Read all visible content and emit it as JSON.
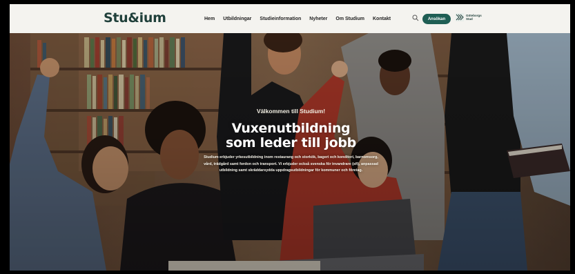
{
  "header": {
    "logo": "Stu&ium",
    "nav": [
      "Hem",
      "Utbildningar",
      "Studieinformation",
      "Nyheter",
      "Om Studium",
      "Kontakt"
    ],
    "apply_label": "Ansökan",
    "city_logo_text": "Göteborgs Stad"
  },
  "hero": {
    "welcome": "Välkommen till Studium!",
    "headline_line1": "Vuxenutbildning",
    "headline_line2": "som leder till jobb",
    "intro": "Studium erbjuder yrkesutbildning inom restaurang och storkök, bageri och konditori, barnomsorg, vård, trädgård samt fordon och transport. Vi erbjuder också svenska för invandrare (sfi), anpassad utbildning samt skräddarsydda uppdragsutbildningar för kommuner och företag."
  },
  "colors": {
    "brand": "#1f5e54",
    "logo": "#1f3f3a",
    "header_bg": "#f4f3ef"
  },
  "icons": {
    "search": "search-icon",
    "city": "goteborg-city-logo"
  }
}
